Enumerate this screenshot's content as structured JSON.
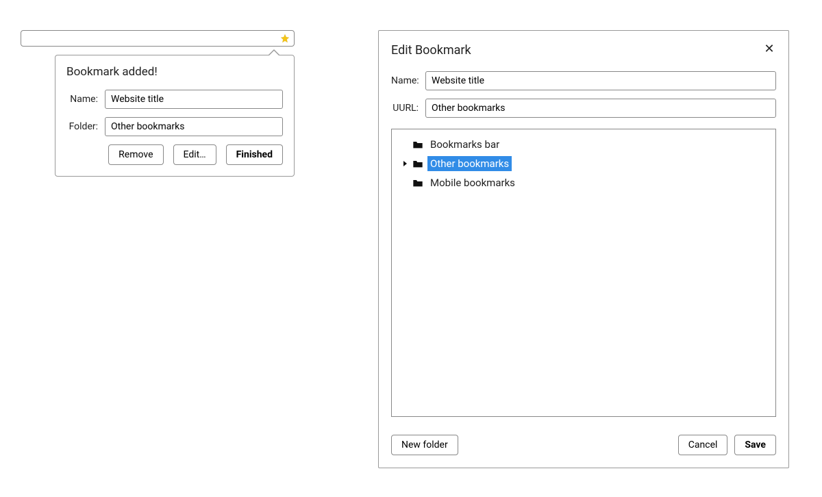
{
  "popover": {
    "title": "Bookmark added!",
    "name_label": "Name:",
    "name_value": "Website title",
    "folder_label": "Folder:",
    "folder_value": "Other bookmarks",
    "remove": "Remove",
    "edit": "Edit…",
    "finished": "Finished"
  },
  "dialog": {
    "title": "Edit Bookmark",
    "close": "✕",
    "name_label": "Name:",
    "name_value": "Website title",
    "url_label": "UURL:",
    "url_value": "Other bookmarks",
    "tree": [
      {
        "label": "Bookmarks bar",
        "selected": false,
        "expanded": false
      },
      {
        "label": "Other bookmarks",
        "selected": true,
        "expanded": true
      },
      {
        "label": "Mobile bookmarks",
        "selected": false,
        "expanded": false
      }
    ],
    "new_folder": "New folder",
    "cancel": "Cancel",
    "save": "Save"
  }
}
